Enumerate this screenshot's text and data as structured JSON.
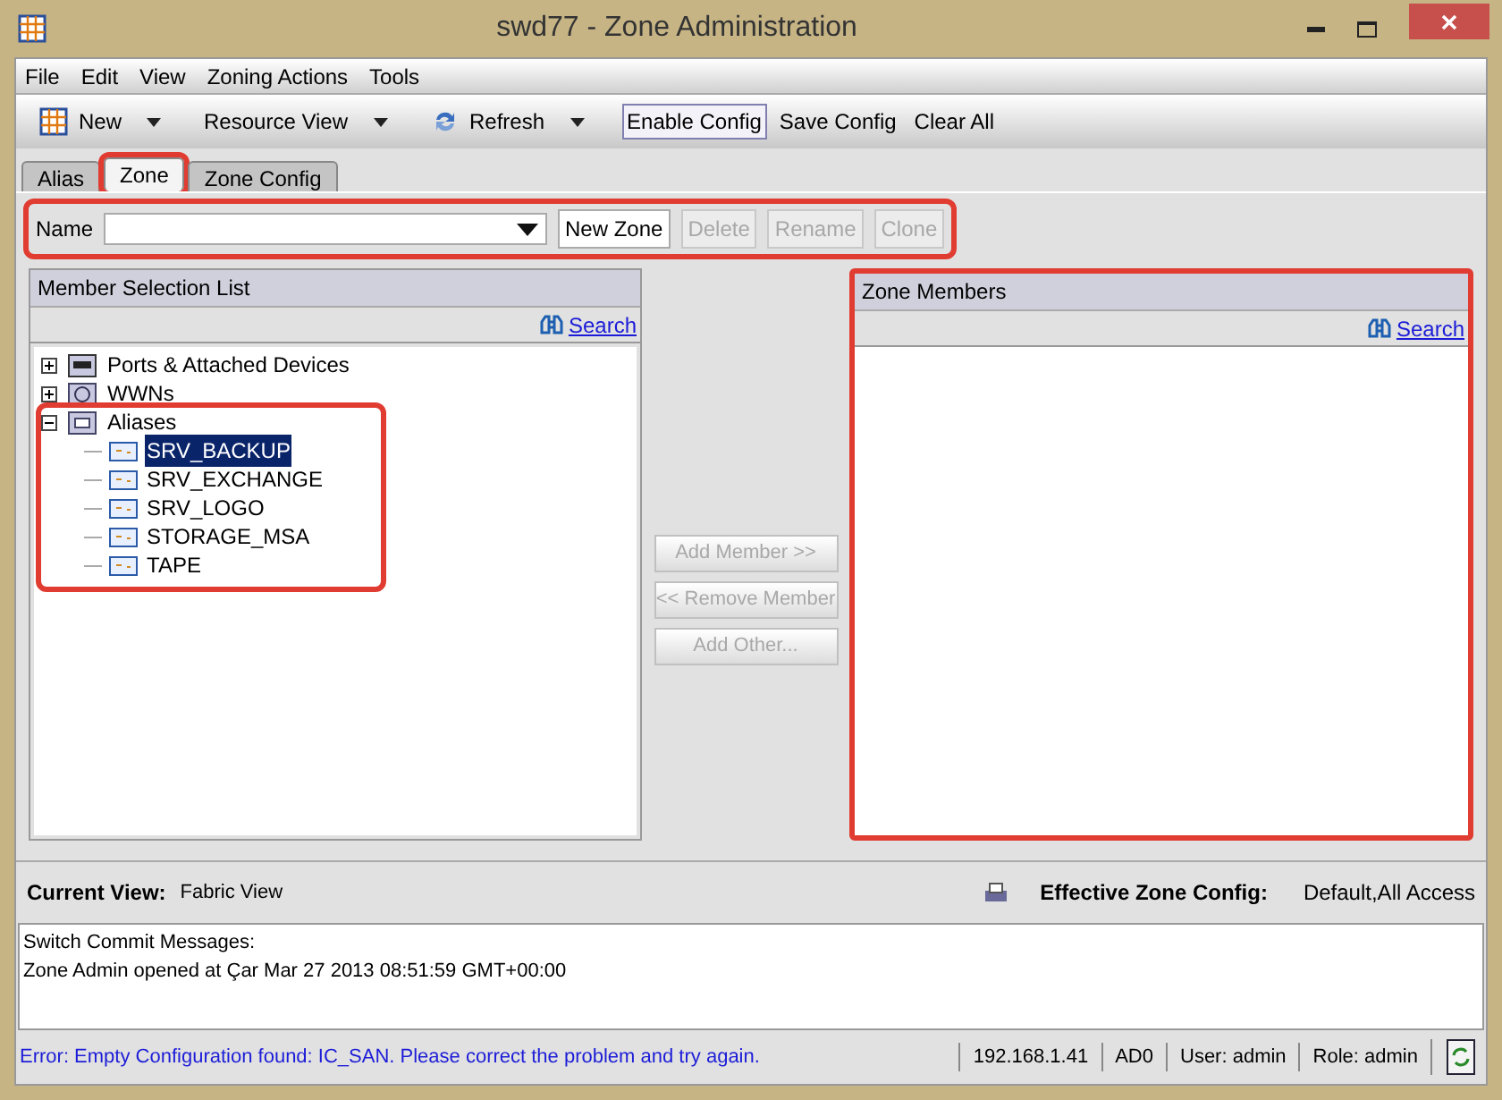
{
  "window": {
    "title": "swd77 - Zone Administration"
  },
  "menu": [
    "File",
    "Edit",
    "View",
    "Zoning Actions",
    "Tools"
  ],
  "toolbar": [
    {
      "kind": "new",
      "label": "New"
    },
    {
      "kind": "view",
      "label": "Resource View"
    },
    {
      "kind": "refresh",
      "label": "Refresh"
    },
    {
      "kind": "button",
      "label": "Enable Config",
      "focused": true
    },
    {
      "kind": "button",
      "label": "Save Config",
      "focused": false
    },
    {
      "kind": "button",
      "label": "Clear All",
      "focused": false
    }
  ],
  "tabs": [
    {
      "label": "Alias",
      "selected": false,
      "highlighted": false
    },
    {
      "label": "Zone",
      "selected": true,
      "highlighted": true
    },
    {
      "label": "Zone Config",
      "selected": false,
      "highlighted": false
    }
  ],
  "name_row": {
    "label": "Name",
    "highlighted": true,
    "buttons": [
      {
        "label": "New Zone",
        "disabled": false
      },
      {
        "label": "Delete",
        "disabled": true
      },
      {
        "label": "Rename",
        "disabled": true
      },
      {
        "label": "Clone",
        "disabled": true
      }
    ]
  },
  "member_list": {
    "title": "Member Selection List",
    "search": "Search",
    "tree": [
      {
        "label": "Ports & Attached Devices",
        "kind": "ports",
        "expanded": false,
        "highlighted": false
      },
      {
        "label": "WWNs",
        "kind": "wwn",
        "expanded": false,
        "highlighted": false
      },
      {
        "label": "Aliases",
        "kind": "alias",
        "expanded": true,
        "highlighted": true,
        "children": [
          {
            "label": "SRV_BACKUP",
            "selected": true
          },
          {
            "label": "SRV_EXCHANGE",
            "selected": false
          },
          {
            "label": "SRV_LOGO",
            "selected": false
          },
          {
            "label": "STORAGE_MSA",
            "selected": false
          },
          {
            "label": "TAPE",
            "selected": false
          }
        ]
      }
    ]
  },
  "middle_buttons": [
    {
      "label": "Add Member >>",
      "disabled": true
    },
    {
      "label": "<< Remove Member",
      "disabled": true
    },
    {
      "label": "Add Other...",
      "disabled": true
    }
  ],
  "zone_members": {
    "title": "Zone Members",
    "search": "Search",
    "highlighted": true
  },
  "view_bar": {
    "current_view_label": "Current View:",
    "current_view": "Fabric View",
    "effective_label": "Effective Zone Config:",
    "effective": "Default,All Access"
  },
  "messages": [
    "Switch Commit Messages:",
    "Zone Admin opened at Çar Mar 27 2013 08:51:59 GMT+00:00"
  ],
  "status_bar": {
    "error": "Error: Empty Configuration found: IC_SAN. Please correct the problem and try again.",
    "fields": [
      "192.168.1.41",
      "AD0",
      "User: admin",
      "Role: admin"
    ]
  }
}
